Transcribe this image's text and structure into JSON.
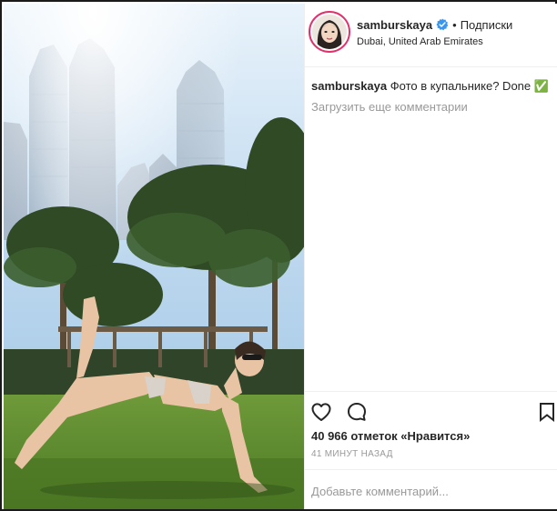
{
  "post": {
    "username": "samburskaya",
    "verified": true,
    "separator": "•",
    "follow_label": "Подписки",
    "location": "Dubai, United Arab Emirates",
    "caption_user": "samburskaya",
    "caption_text": "Фото в купальнике? Done ✅",
    "load_more_label": "Загрузить еще комментарии",
    "likes_label": "40 966 отметок «Нравится»",
    "time_label": "41 МИНУТ НАЗАД",
    "comment_placeholder": "Добавьте комментарий..."
  },
  "icons": {
    "like": "heart-outline",
    "comment": "speech-bubble",
    "save": "bookmark-outline",
    "verified": "blue-check-badge"
  },
  "colors": {
    "verified_blue": "#3897f0",
    "muted_text": "#999999",
    "text": "#262626",
    "story_ring": "#e1306c"
  }
}
